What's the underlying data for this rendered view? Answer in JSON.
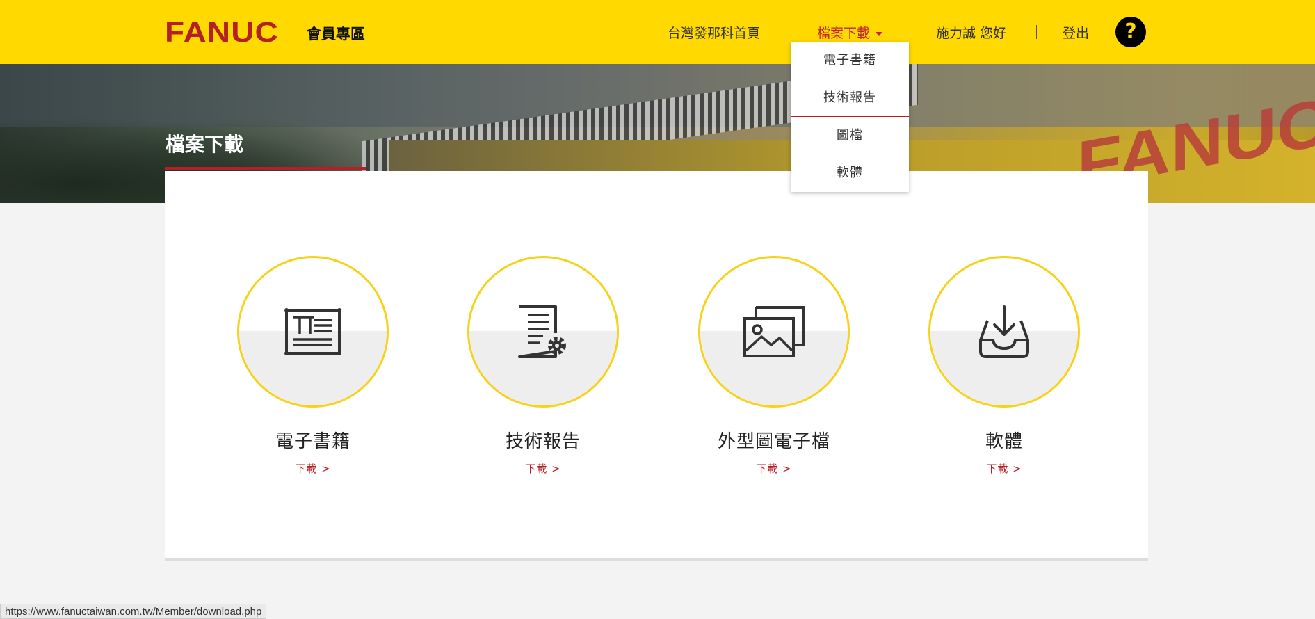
{
  "header": {
    "logo": "FANUC",
    "logo_sub": "會員專區",
    "nav": {
      "home": "台灣發那科首頁",
      "download": "檔案下載",
      "user_greeting": "施力誠 您好",
      "logout": "登出",
      "help": "?"
    },
    "accent_color": "#ffd900",
    "brand_color": "#b52024"
  },
  "dropdown": {
    "items": [
      "電子書籍",
      "技術報告",
      "圖檔",
      "軟體"
    ]
  },
  "banner": {
    "title": "檔案下載",
    "sign_text": "FANUC"
  },
  "cards": [
    {
      "title": "電子書籍",
      "link": "下載 >",
      "icon": "ebook-icon"
    },
    {
      "title": "技術報告",
      "link": "下載 >",
      "icon": "report-settings-icon"
    },
    {
      "title": "外型圖電子檔",
      "link": "下載 >",
      "icon": "images-icon"
    },
    {
      "title": "軟體",
      "link": "下載 >",
      "icon": "download-tray-icon"
    }
  ],
  "statusbar": {
    "url": "https://www.fanuctaiwan.com.tw/Member/download.php"
  }
}
